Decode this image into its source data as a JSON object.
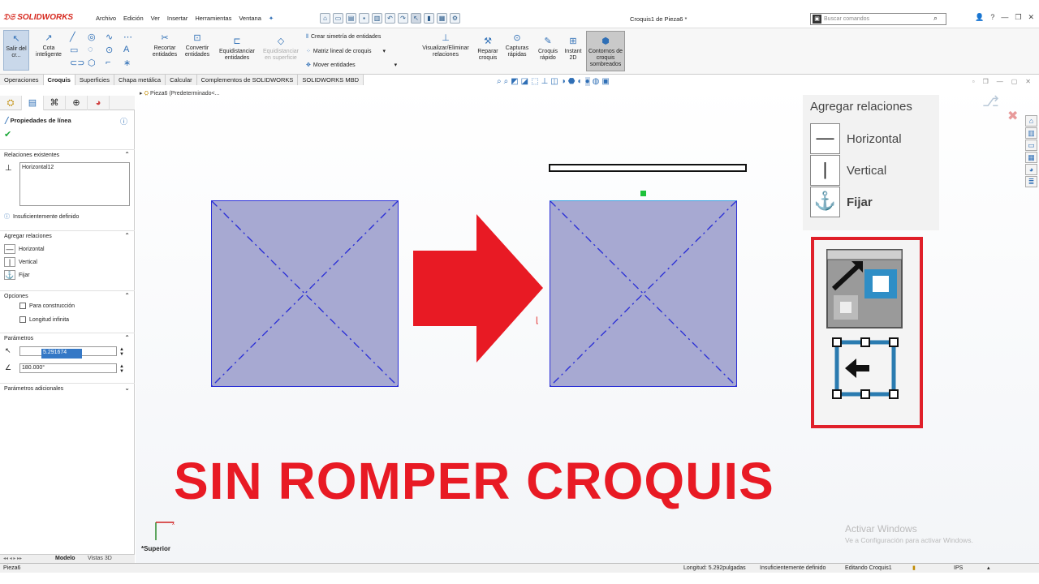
{
  "app": {
    "brand": "SOLIDWORKS",
    "document_title": "Croquis1 de Pieza6 *"
  },
  "menu": [
    "Archivo",
    "Edición",
    "Ver",
    "Insertar",
    "Herramientas",
    "Ventana"
  ],
  "search": {
    "placeholder": "Buscar comandos"
  },
  "ribbon": {
    "exit_sketch": "Salir del cr...",
    "smart_dimension": "Cota inteligente",
    "trim": "Recortar entidades",
    "convert": "Convertir entidades",
    "offset": "Equidistanciar entidades",
    "offset_surface": "Equidistanciar en superficie",
    "mirror": "Crear simetría de entidades",
    "linear_pattern": "Matriz lineal de croquis",
    "move": "Mover entidades",
    "display_relations": "Visualizar/Eliminar relaciones",
    "repair": "Reparar croquis",
    "quick_snaps": "Capturas rápidas",
    "rapid_sketch": "Croquis rápido",
    "instant2d": "Instant 2D",
    "shaded_contours": "Contornos de croquis sombreados"
  },
  "tabs": [
    "Operaciones",
    "Croquis",
    "Superficies",
    "Chapa metálica",
    "Calcular",
    "Complementos de SOLIDWORKS",
    "SOLIDWORKS MBD"
  ],
  "active_tab": "Croquis",
  "tree": {
    "root": "Pieza6 (Predeterminado<..."
  },
  "property_manager": {
    "title": "Propiedades de línea",
    "existing_relations_header": "Relaciones existentes",
    "existing_relations": [
      "Horizontal12"
    ],
    "status": "Insuficientemente definido",
    "add_relations_header": "Agregar relaciones",
    "add_relations": [
      "Horizontal",
      "Vertical",
      "Fijar"
    ],
    "options_header": "Opciones",
    "options": [
      "Para construcción",
      "Longitud infinita"
    ],
    "parameters_header": "Parámetros",
    "length_value": "5.291674",
    "angle_value": "180.000°",
    "additional_header": "Parámetros adicionales"
  },
  "bottom_tabs": [
    "Modelo",
    "Vistas 3D"
  ],
  "view_label": "*Superior",
  "overlay": {
    "heading": "SIN ROMPER CROQUIS",
    "relations_title": "Agregar relaciones",
    "relations": [
      "Horizontal",
      "Vertical",
      "Fijar"
    ]
  },
  "watermark": {
    "line1": "Activar Windows",
    "line2": "Ve a Configuración para activar Windows."
  },
  "status": {
    "left": "Pieza6",
    "length": "Longitud: 5.292pulgadas",
    "definition": "Insuficientemente definido",
    "editing": "Editando Croquis1",
    "units": "IPS"
  },
  "colors": {
    "accent": "#2f6fb6",
    "highlight": "#e81a24",
    "sketch_fill": "#a7a9d2",
    "sketch_line": "#2b2fd6"
  }
}
